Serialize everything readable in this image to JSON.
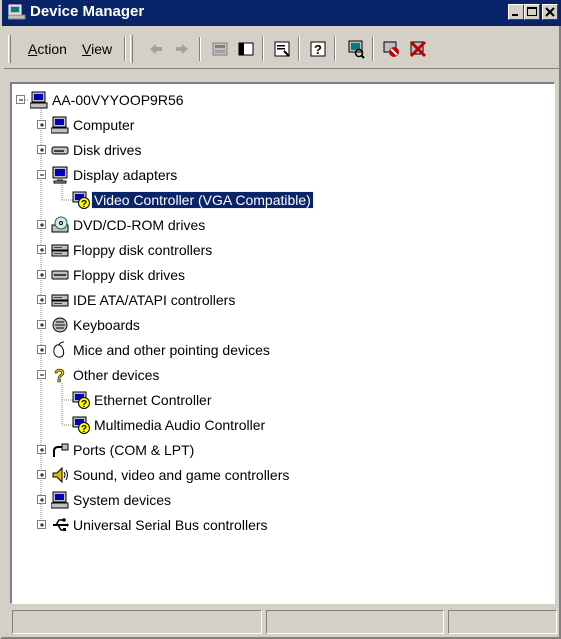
{
  "window": {
    "title": "Device Manager"
  },
  "toolbar": {
    "menus": [
      {
        "label": "Action",
        "accel": "A",
        "rest": "ction"
      },
      {
        "label": "View",
        "accel": "V",
        "rest": "iew"
      }
    ],
    "tools": [
      "back-icon",
      "forward-icon",
      "up-icon",
      "show-hide-tree-icon",
      "properties-icon",
      "help-icon",
      "scan-hardware-icon",
      "disable-device-icon",
      "uninstall-device-icon"
    ]
  },
  "tree": {
    "root": "AA-00VYYOOP9R56",
    "nodes": [
      {
        "label": "Computer",
        "expanded": false,
        "icon": "computer-icon",
        "children": []
      },
      {
        "label": "Disk drives",
        "expanded": false,
        "icon": "disk-drive-icon",
        "children": []
      },
      {
        "label": "Display adapters",
        "expanded": true,
        "icon": "monitor-icon",
        "children": [
          {
            "label": "Video Controller (VGA Compatible)",
            "icon": "unknown-device-icon",
            "selected": true
          }
        ]
      },
      {
        "label": "DVD/CD-ROM drives",
        "expanded": false,
        "icon": "cdrom-icon",
        "children": []
      },
      {
        "label": "Floppy disk controllers",
        "expanded": false,
        "icon": "controller-icon",
        "children": []
      },
      {
        "label": "Floppy disk drives",
        "expanded": false,
        "icon": "floppy-drive-icon",
        "children": []
      },
      {
        "label": "IDE ATA/ATAPI controllers",
        "expanded": false,
        "icon": "controller-icon",
        "children": []
      },
      {
        "label": "Keyboards",
        "expanded": false,
        "icon": "keyboard-icon",
        "children": []
      },
      {
        "label": "Mice and other pointing devices",
        "expanded": false,
        "icon": "mouse-icon",
        "children": []
      },
      {
        "label": "Other devices",
        "expanded": true,
        "icon": "question-icon",
        "children": [
          {
            "label": "Ethernet Controller",
            "icon": "unknown-device-icon"
          },
          {
            "label": "Multimedia Audio Controller",
            "icon": "unknown-device-icon"
          }
        ]
      },
      {
        "label": "Ports (COM & LPT)",
        "expanded": false,
        "icon": "port-icon",
        "children": []
      },
      {
        "label": "Sound, video and game controllers",
        "expanded": false,
        "icon": "speaker-icon",
        "children": []
      },
      {
        "label": "System devices",
        "expanded": false,
        "icon": "computer-icon",
        "children": []
      },
      {
        "label": "Universal Serial Bus controllers",
        "expanded": false,
        "icon": "usb-icon",
        "children": []
      }
    ]
  },
  "colors": {
    "titlebar": "#0a246a",
    "face": "#d4d0c8",
    "selection": "#0a246a"
  }
}
